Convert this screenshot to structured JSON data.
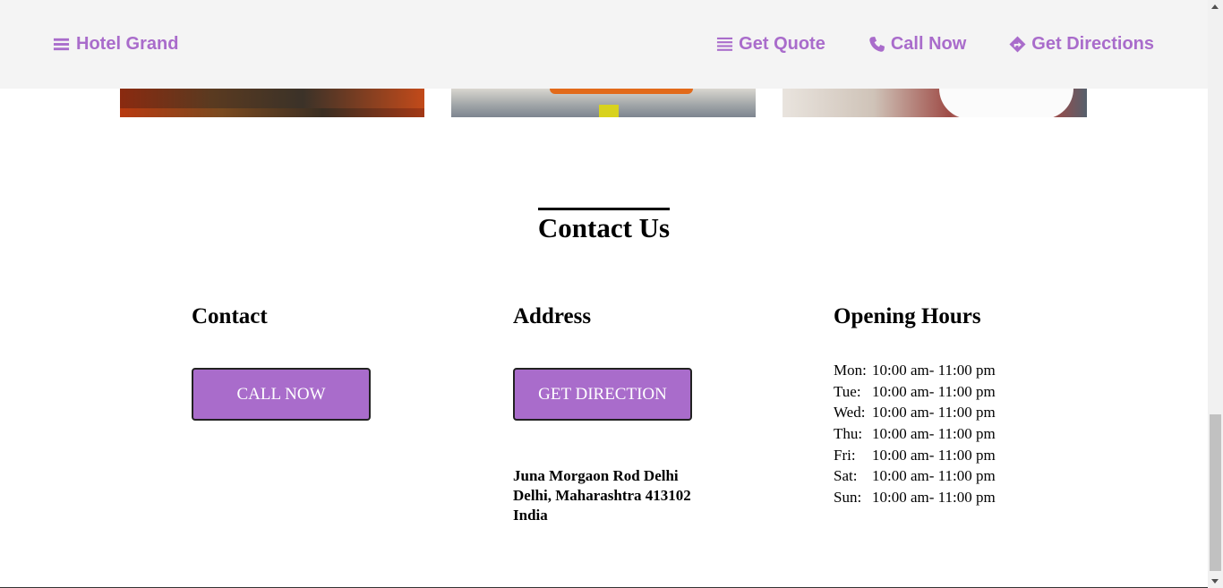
{
  "header": {
    "brand": "Hotel Grand",
    "nav": [
      {
        "label": "Get Quote",
        "icon": "list-icon"
      },
      {
        "label": "Call Now",
        "icon": "phone-icon"
      },
      {
        "label": "Get Directions",
        "icon": "directions-icon"
      }
    ]
  },
  "section": {
    "title": "Contact Us"
  },
  "contact": {
    "heading": "Contact",
    "button": "CALL NOW"
  },
  "address": {
    "heading": "Address",
    "button": "GET DIRECTION",
    "lines": [
      "Juna Morgaon Rod Delhi",
      "Delhi, Maharashtra 413102",
      "India"
    ]
  },
  "hours": {
    "heading": "Opening Hours",
    "rows": [
      {
        "day": "Mon:",
        "time": "10:00 am- 11:00 pm"
      },
      {
        "day": "Tue:",
        "time": "10:00 am- 11:00 pm"
      },
      {
        "day": "Wed:",
        "time": "10:00 am- 11:00 pm"
      },
      {
        "day": "Thu:",
        "time": "10:00 am- 11:00 pm"
      },
      {
        "day": "Fri:",
        "time": "10:00 am- 11:00 pm"
      },
      {
        "day": "Sat:",
        "time": "10:00 am- 11:00 pm"
      },
      {
        "day": "Sun:",
        "time": "10:00 am- 11:00 pm"
      }
    ]
  },
  "colors": {
    "accent": "#a96ccb",
    "header_bg": "#f4f4f4"
  }
}
